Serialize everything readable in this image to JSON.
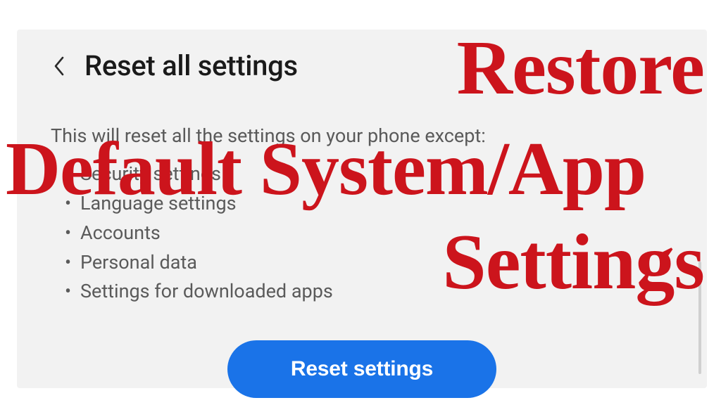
{
  "header": {
    "title": "Reset all settings"
  },
  "body": {
    "description": "This will reset all the settings on your phone except:",
    "exceptions": [
      "Security settings",
      "Language settings",
      "Accounts",
      "Personal data",
      "Settings for downloaded apps"
    ]
  },
  "button": {
    "label": "Reset settings"
  },
  "overlay": {
    "line1": "Restore",
    "line2": "Default System/App",
    "line3": "Settings"
  },
  "colors": {
    "overlay_red": "#cc141c",
    "button_blue": "#1a73e8",
    "panel_bg": "#f2f2f2"
  }
}
